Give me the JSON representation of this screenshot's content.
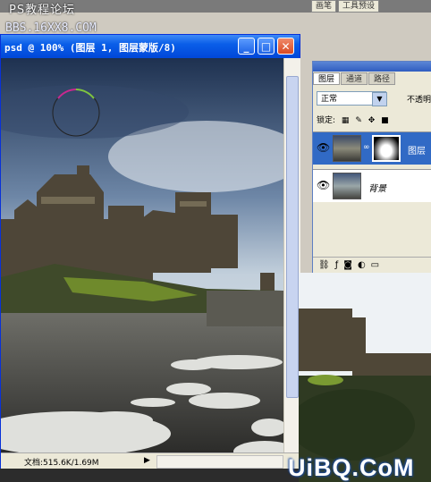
{
  "watermarks": {
    "top": "PS教程论坛",
    "bbs": "BBS.16XX8.COM",
    "bottom": "UiBQ.CoM"
  },
  "menu_tabs": [
    "画笔",
    "工具预设"
  ],
  "document": {
    "title": "psd @ 100% (图层 1, 图层蒙版/8)",
    "minimize": "_",
    "maximize": "□",
    "close": "✕",
    "status": "文档:515.6K/1.69M",
    "status_arrow": "▶"
  },
  "layers_panel": {
    "tabs": [
      "图层",
      "通道",
      "路径"
    ],
    "active_tab": "图层",
    "blend_mode": "正常",
    "opacity_label": "不透明",
    "lock_label": "锁定:",
    "layers": [
      {
        "name": "图层",
        "visible": true,
        "selected": true,
        "has_mask": true
      },
      {
        "name": "背景",
        "visible": true,
        "selected": false,
        "has_mask": false
      }
    ],
    "bottom_icons": [
      "link-icon",
      "fx-icon",
      "mask-icon",
      "adjustment-icon",
      "folder-icon"
    ]
  },
  "colors": {
    "titlebar": "#0a5ee8",
    "selection": "#316ac5",
    "panel_bg": "#ece9d8"
  }
}
